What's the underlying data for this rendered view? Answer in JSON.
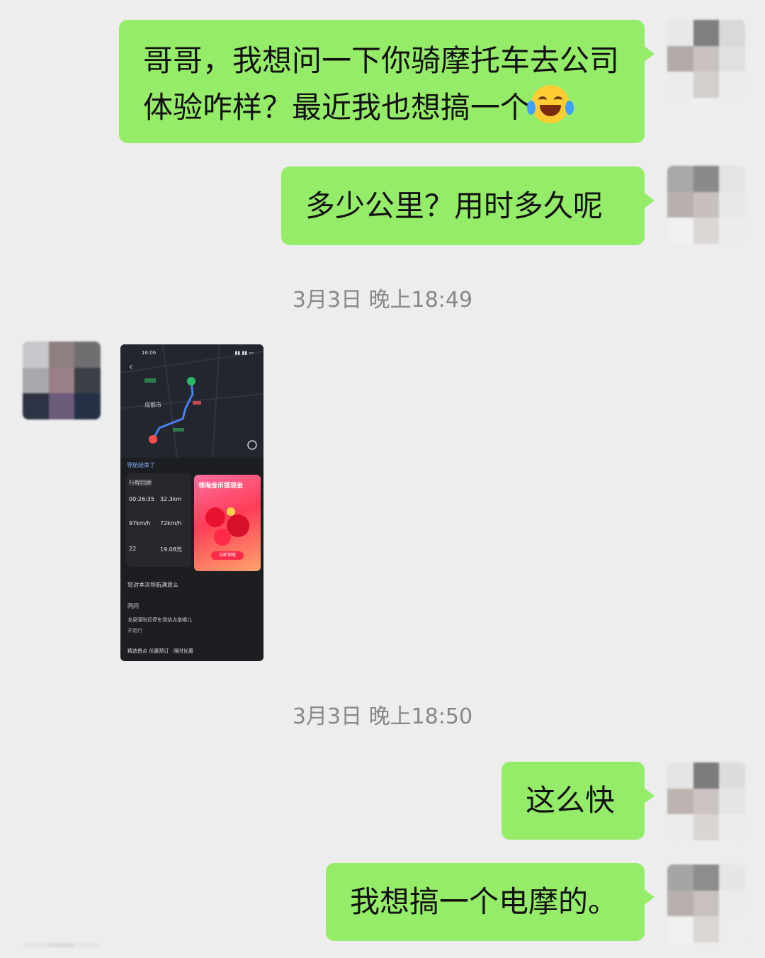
{
  "messages": {
    "m1": {
      "text": "哥哥，我想问一下你骑摩托车去公司体验咋样？最近我也想搞一个",
      "emoji": "laugh-cry-emoji"
    },
    "m2": {
      "text": "多少公里？用时多久呢"
    },
    "m3": {
      "text": "这么快"
    },
    "m4": {
      "text": "我想搞一个电摩的。"
    }
  },
  "timestamps": {
    "t1": "3月3日 晚上18:49",
    "t2": "3月3日 晚上18:50"
  },
  "screenshot": {
    "status_time": "16:06",
    "city": "成都市",
    "nav_done": "导航结束了",
    "trip_title": "行程回顾",
    "duration": "00:26:35",
    "distance": "32.3km",
    "max_speed": "97km/h",
    "avg_speed": "72km/h",
    "count": "22",
    "cost": "19.08元",
    "ad_title": "领淘金币提现金",
    "ad_button": "立即领取",
    "question": "您对本次导航满意么",
    "same_title": "同问",
    "line1": "龙泉驿附近停车场站点是哪儿",
    "line2": "开始行",
    "footer": "精选景点 优惠预订 · 限时优惠"
  },
  "colors": {
    "bubble": "#95ec69",
    "background": "#ededed"
  }
}
